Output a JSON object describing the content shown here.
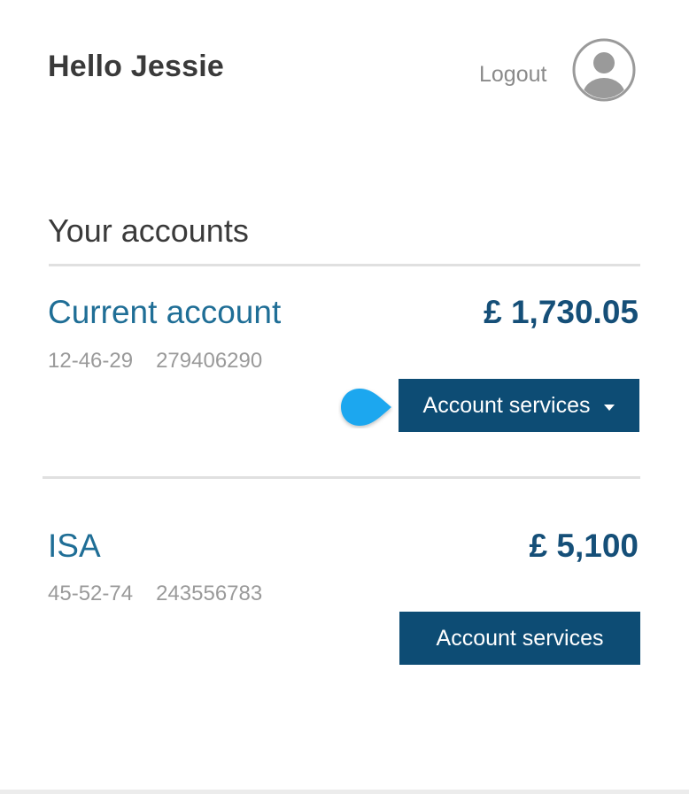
{
  "header": {
    "greeting": "Hello Jessie",
    "logout_label": "Logout",
    "avatar_icon": "user-avatar-icon"
  },
  "accounts_section": {
    "title": "Your accounts",
    "accounts": [
      {
        "name": "Current account",
        "balance": "£ 1,730.05",
        "sort_code": "12-46-29",
        "account_number": "279406290",
        "services_label": "Account services",
        "dropdown_icon": "caret-down-icon"
      },
      {
        "name": "ISA",
        "balance": "£ 5,100",
        "sort_code": "45-52-74",
        "account_number": "243556783",
        "services_label": "Account services"
      }
    ]
  },
  "hotspot": {
    "icon": "hotspot-marker-icon"
  },
  "colors": {
    "accent_blue": "#1f6e96",
    "button_blue": "#0d4c74",
    "hotspot_blue": "#1aa7ef"
  }
}
